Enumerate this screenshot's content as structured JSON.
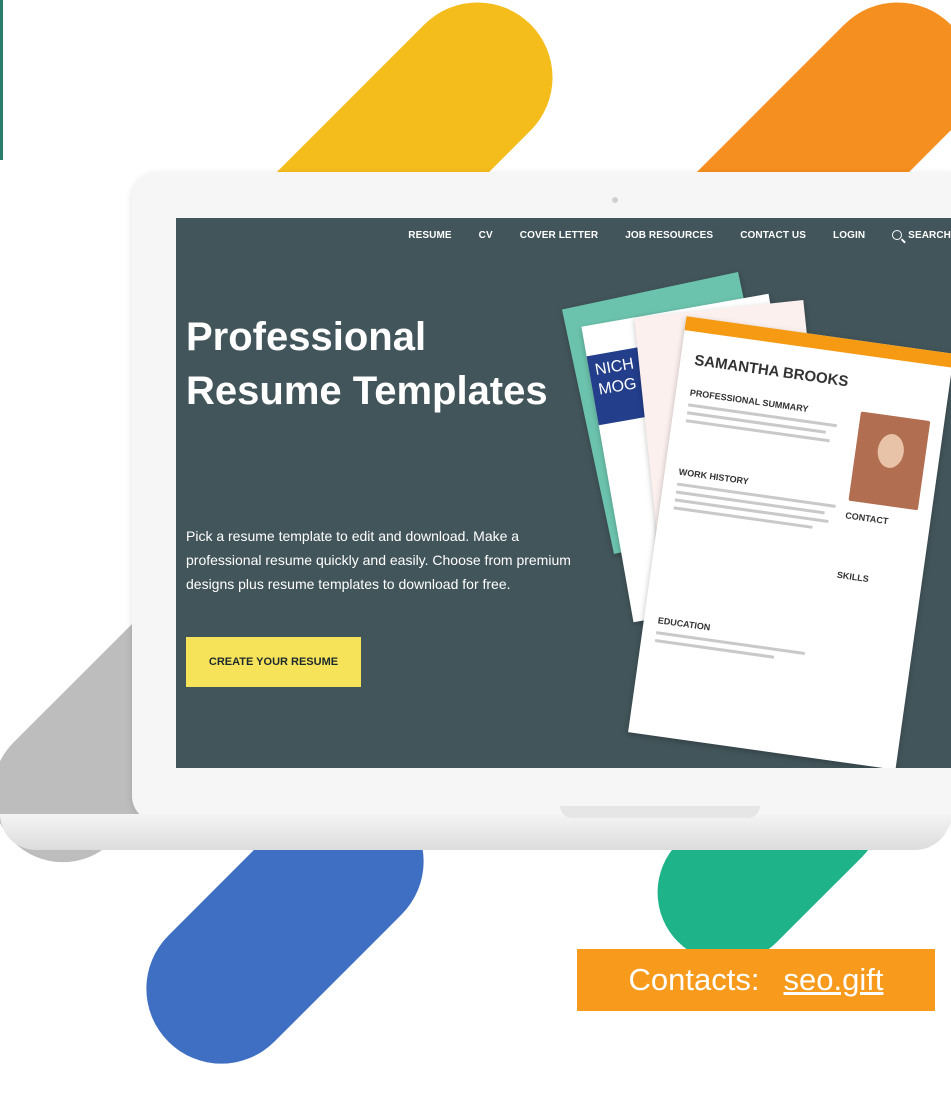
{
  "nav": {
    "items": [
      "RESUME",
      "CV",
      "COVER LETTER",
      "JOB RESOURCES",
      "CONTACT US",
      "LOGIN"
    ],
    "search_label": "SEARCH"
  },
  "hero": {
    "title": "Professional Resume Templates",
    "description": "Pick a resume template to edit and download. Make a professional resume quickly and easily. Choose from premium designs plus resume templates to download for free.",
    "cta_label": "CREATE YOUR RESUME"
  },
  "resume_preview": {
    "name": "SAMANTHA BROOKS",
    "back_name": "NICH MOG",
    "sections": [
      "PROFESSIONAL SUMMARY",
      "WORK HISTORY",
      "EDUCATION",
      "CONTACT",
      "SKILLS"
    ]
  },
  "badge": {
    "label": "Contacts:",
    "link": "seo.gift"
  },
  "colors": {
    "screen_bg": "#42555a",
    "cta_bg": "#f7e35a",
    "badge_bg": "#f89a1c",
    "resume_accent": "#f59a12"
  }
}
